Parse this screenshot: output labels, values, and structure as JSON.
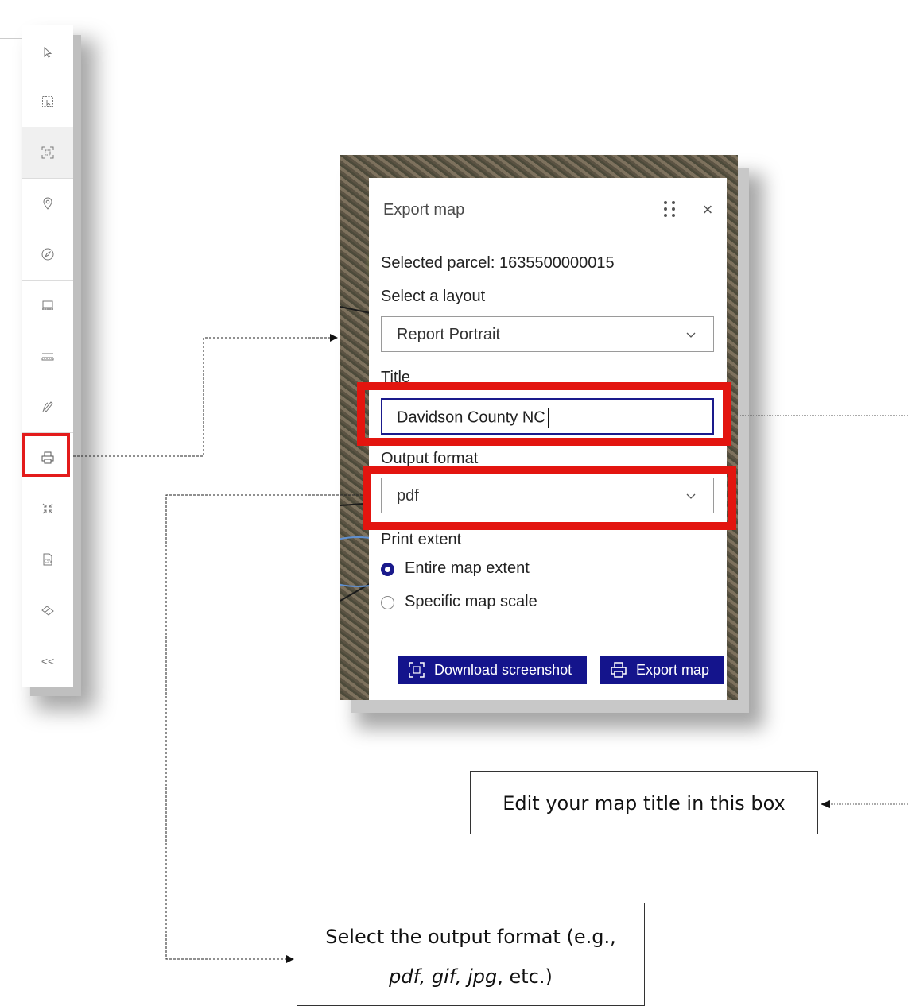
{
  "toolbar": {
    "tools": [
      {
        "name": "select-arrow-icon"
      },
      {
        "name": "select-by-rectangle-icon"
      },
      {
        "name": "zoom-to-extent-icon"
      },
      {
        "name": "location-pin-icon"
      },
      {
        "name": "compass-icon"
      },
      {
        "name": "measure-area-icon"
      },
      {
        "name": "measure-distance-icon"
      },
      {
        "name": "draw-icon"
      },
      {
        "name": "print-icon"
      },
      {
        "name": "collapse-arrows-icon"
      },
      {
        "name": "csv-export-icon"
      },
      {
        "name": "eraser-icon"
      },
      {
        "name": "collapse-toolbar-icon"
      }
    ],
    "collapse_label": "<<",
    "highlight_color": "#e31b1b"
  },
  "dialog": {
    "title": "Export map",
    "selected_parcel": "Selected parcel: 1635500000015",
    "layout_label": "Select a layout",
    "layout_value": "Report Portrait",
    "title_label": "Title",
    "title_value": "Davidson County NC",
    "output_format_label": "Output format",
    "output_format_value": "pdf",
    "print_extent_label": "Print extent",
    "extent_options": [
      {
        "label": "Entire map extent",
        "selected": true
      },
      {
        "label": "Specific map scale",
        "selected": false
      }
    ],
    "download_button": "Download screenshot",
    "export_button": "Export map",
    "accent_color": "#14148c"
  },
  "callouts": {
    "title_hint": "Edit your map title in this box",
    "format_hint_line1": "Select the output format (e.g.,",
    "format_hint_line2_italic": "pdf, gif, jpg",
    "format_hint_line2_rest": ", etc.)"
  }
}
